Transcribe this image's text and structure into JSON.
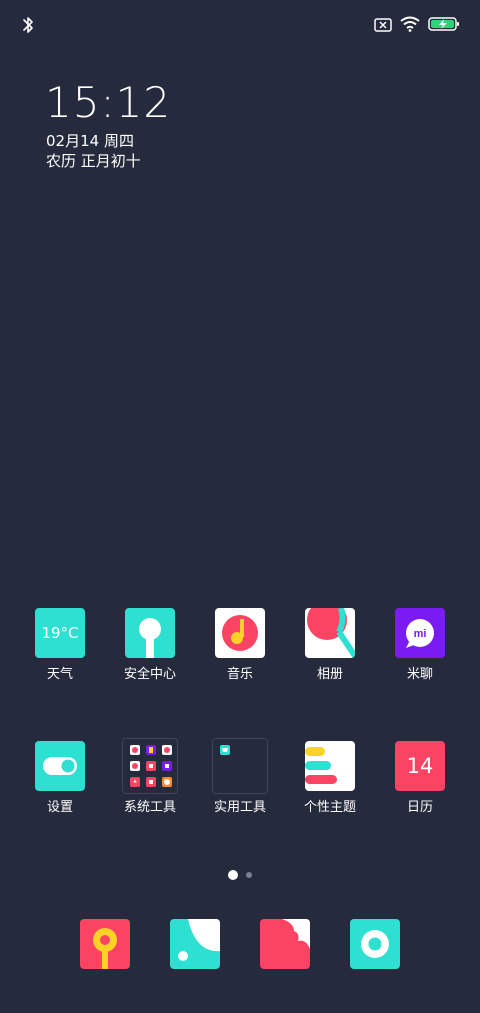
{
  "status": {
    "bluetooth_icon": "bluetooth-icon",
    "sim_icon": "no-sim-icon",
    "wifi_icon": "wifi-icon",
    "battery_icon": "battery-charging-icon"
  },
  "lockclock": {
    "time": "15:12",
    "date": "02月14 周四",
    "lunar": "农历 正月初十"
  },
  "row1": [
    {
      "label": "天气",
      "tile_text": "19°C",
      "color": "#2ee0d1"
    },
    {
      "label": "安全中心",
      "color": "#2ee0d1"
    },
    {
      "label": "音乐",
      "color": "#ffffff"
    },
    {
      "label": "相册",
      "color": "#ffffff"
    },
    {
      "label": "米聊",
      "tile_text": "mi",
      "color": "#7a1bf2"
    }
  ],
  "row2": [
    {
      "label": "设置",
      "color": "#2ee0d1"
    },
    {
      "label": "系统工具"
    },
    {
      "label": "实用工具"
    },
    {
      "label": "个性主题",
      "color": "#ffffff"
    },
    {
      "label": "日历",
      "tile_text": "14",
      "color": "#fb4364"
    }
  ],
  "pages": {
    "count": 2,
    "current": 1
  },
  "dock": [
    {
      "name": "phone",
      "color": "#fb4364"
    },
    {
      "name": "contacts",
      "color": "#2ee0d1"
    },
    {
      "name": "messages",
      "color": "#fb4364"
    },
    {
      "name": "camera",
      "color": "#2ee0d1"
    }
  ],
  "colors": {
    "background": "#262a3d",
    "teal": "#2ee0d1",
    "pink": "#fb4364",
    "purple": "#7a1bf2",
    "yellow": "#fbd226"
  }
}
